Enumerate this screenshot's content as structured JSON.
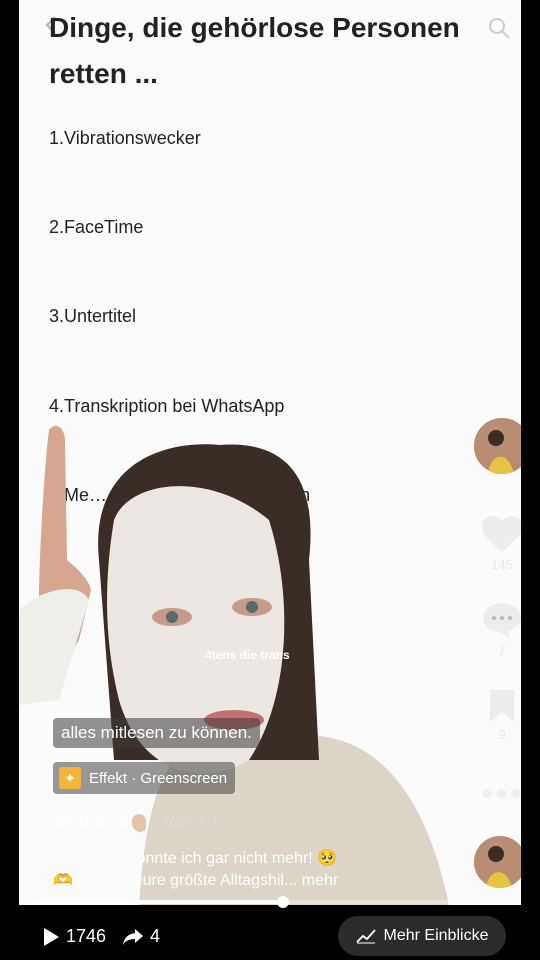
{
  "slide": {
    "title": "Dinge, die gehörlose Personen retten ...",
    "items": [
      "1.Vibrationswecker",
      "2.FaceTime",
      "3.Untertitel",
      "4.Transkription bei WhatsApp",
      "5.Me…                        den Augenkontakt halten"
    ]
  },
  "overlay_text": "4tens die trans",
  "caption": "alles mitlesen zu können.",
  "effect": {
    "label": "Effekt · Greenscreen",
    "icon": "effect-sparkle-icon"
  },
  "user": {
    "name": "deaf.tara",
    "meta": "· Vor 3 T."
  },
  "description": {
    "line1": "ohne nr. 4 könnte ich gar nicht mehr! 🥺",
    "line2": "🫶 Was ist eure größte Alltagshil... mehr"
  },
  "rail": {
    "likes": "145",
    "comments": "7",
    "saves": "9"
  },
  "progress": 0.53,
  "bottom": {
    "plays": "1746",
    "shares": "4",
    "insights_label": "Mehr Einblicke"
  }
}
